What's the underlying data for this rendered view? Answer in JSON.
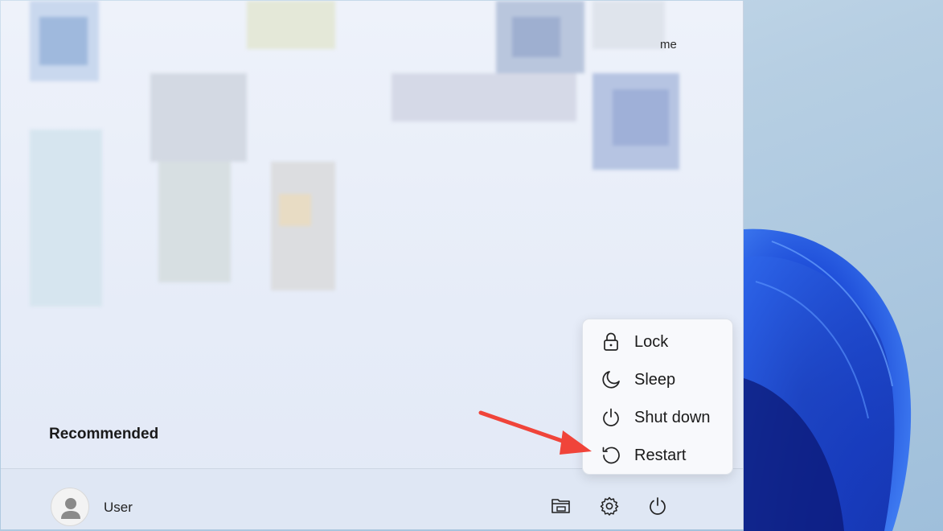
{
  "start_menu": {
    "partial_pinned_label": "me",
    "recommended_heading": "Recommended"
  },
  "footer": {
    "user_name": "User",
    "icons": [
      "file-explorer-icon",
      "settings-icon",
      "power-icon"
    ]
  },
  "power_menu": {
    "items": [
      {
        "label": "Lock",
        "icon": "lock-icon"
      },
      {
        "label": "Sleep",
        "icon": "sleep-moon-icon"
      },
      {
        "label": "Shut down",
        "icon": "shut-down-icon"
      },
      {
        "label": "Restart",
        "icon": "restart-icon"
      }
    ]
  },
  "colors": {
    "annotation_arrow": "#f0443a",
    "wallpaper_bloom": "#1b49d6"
  }
}
